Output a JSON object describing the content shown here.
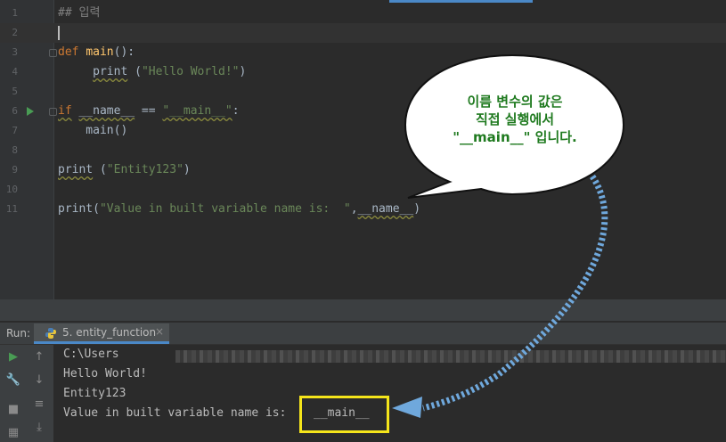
{
  "editor": {
    "lines": [
      {
        "num": "1",
        "tokens": [
          {
            "t": "## 입력",
            "c": "cmt"
          }
        ]
      },
      {
        "num": "2",
        "tokens": [],
        "current": true
      },
      {
        "num": "3",
        "tokens": [
          {
            "t": "def",
            "c": "kw"
          },
          {
            "t": " "
          },
          {
            "t": "main",
            "c": "fn"
          },
          {
            "t": "():"
          }
        ]
      },
      {
        "num": "4",
        "tokens": [
          {
            "t": "     "
          },
          {
            "t": "print",
            "c": "wavy"
          },
          {
            "t": " ("
          },
          {
            "t": "\"Hello World!\"",
            "c": "str"
          },
          {
            "t": ")"
          }
        ]
      },
      {
        "num": "5",
        "tokens": []
      },
      {
        "num": "6",
        "tokens": [
          {
            "t": "if",
            "c": "kw wavy"
          },
          {
            "t": " "
          },
          {
            "t": "__name__",
            "c": "wavy"
          },
          {
            "t": " == "
          },
          {
            "t": "\"__main__\"",
            "c": "str wavy"
          },
          {
            "t": ":"
          }
        ],
        "run": true
      },
      {
        "num": "7",
        "tokens": [
          {
            "t": "    main()"
          }
        ]
      },
      {
        "num": "8",
        "tokens": []
      },
      {
        "num": "9",
        "tokens": [
          {
            "t": "print",
            "c": "wavy"
          },
          {
            "t": " ("
          },
          {
            "t": "\"Entity123\"",
            "c": "str"
          },
          {
            "t": ")"
          }
        ]
      },
      {
        "num": "10",
        "tokens": []
      },
      {
        "num": "11",
        "tokens": [
          {
            "t": "print("
          },
          {
            "t": "\"Value in built variable name is:  \"",
            "c": "str"
          },
          {
            "t": ","
          },
          {
            "t": "__name__",
            "c": "wavy"
          },
          {
            "t": ")"
          }
        ]
      }
    ]
  },
  "run": {
    "label": "Run:",
    "tab_label": "5. entity_function",
    "tab_close": "×",
    "output": [
      "C:\\Users",
      "Hello World!",
      "Entity123",
      "Value in built variable name is:"
    ],
    "highlight_value": "__main__"
  },
  "callout": {
    "line1": "이름 변수의 값은",
    "line2": "직접 실행에서",
    "line3": "\"__main__\" 입니다."
  },
  "colors": {
    "callout_text": "#1f7a1f",
    "highlight_border": "#f5e51b",
    "arrow": "#6fa8dc"
  }
}
